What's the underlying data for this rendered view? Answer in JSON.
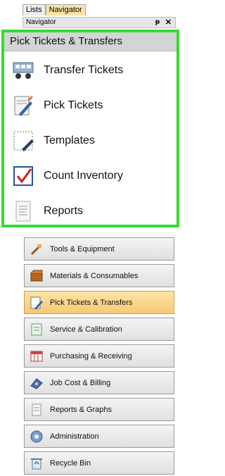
{
  "tabs": [
    {
      "label": "Lists",
      "active": false
    },
    {
      "label": "Navigator",
      "active": true
    }
  ],
  "navigator": {
    "title": "Navigator",
    "pin_glyph": "ᵽ",
    "close_glyph": "✕"
  },
  "panel": {
    "title": "Pick Tickets & Transfers",
    "items": [
      {
        "label": "Transfer Tickets",
        "icon": "transfer-tickets-icon"
      },
      {
        "label": "Pick Tickets",
        "icon": "pick-tickets-icon"
      },
      {
        "label": "Templates",
        "icon": "templates-icon"
      },
      {
        "label": "Count Inventory",
        "icon": "count-inventory-icon"
      },
      {
        "label": "Reports",
        "icon": "reports-icon"
      }
    ]
  },
  "nav_buttons": [
    {
      "label": "Tools & Equipment",
      "icon": "tools-icon",
      "active": false
    },
    {
      "label": "Materials & Consumables",
      "icon": "materials-icon",
      "active": false
    },
    {
      "label": "Pick Tickets & Transfers",
      "icon": "pick-tickets-icon",
      "active": true
    },
    {
      "label": "Service & Calibration",
      "icon": "service-icon",
      "active": false
    },
    {
      "label": "Purchasing & Receiving",
      "icon": "purchasing-icon",
      "active": false
    },
    {
      "label": "Job Cost & Billing",
      "icon": "job-cost-icon",
      "active": false
    },
    {
      "label": "Reports & Graphs",
      "icon": "reports-graphs-icon",
      "active": false
    },
    {
      "label": "Administration",
      "icon": "administration-icon",
      "active": false
    },
    {
      "label": "Recycle Bin",
      "icon": "recycle-bin-icon",
      "active": false
    }
  ],
  "colors": {
    "highlight_border": "#33dd33",
    "active_tab": "#fbe4a8",
    "active_button": "#f7c873"
  }
}
